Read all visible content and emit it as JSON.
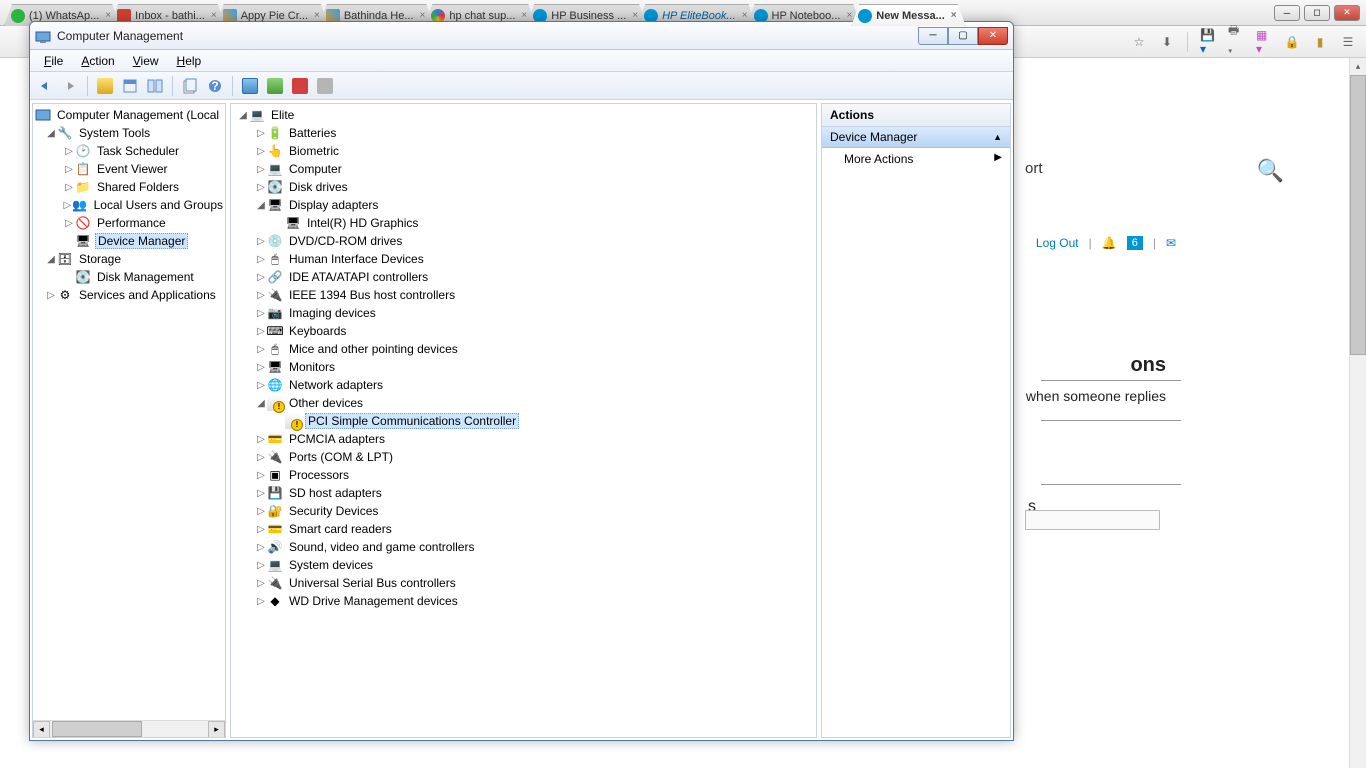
{
  "browser": {
    "tabs": [
      {
        "label": "(1) WhatsAp...",
        "fav": "#2ab540"
      },
      {
        "label": "Inbox - bathi...",
        "fav": "#d04030"
      },
      {
        "label": "Appy Pie Cr...",
        "fav": "#3a88c8"
      },
      {
        "label": "Bathinda He...",
        "fav": "#3a88c8"
      },
      {
        "label": "hp chat sup...",
        "fav": "#3b78e0"
      },
      {
        "label": "HP Business ...",
        "fav": "#0096d6"
      },
      {
        "label": "HP EliteBook...",
        "fav": "#0096d6",
        "italic": true
      },
      {
        "label": "HP Noteboo...",
        "fav": "#0096d6"
      },
      {
        "label": "New Messa...",
        "fav": "#0096d6",
        "active": true
      }
    ],
    "toolbar_icons": [
      "star",
      "download",
      "save",
      "print",
      "apps",
      "lock",
      "library",
      "menu"
    ]
  },
  "bg": {
    "logout": "Log Out",
    "notif_count": "6",
    "section1": "ons",
    "section1_sub": "when someone replies",
    "section2_tail": "s",
    "support_tail": "ort"
  },
  "mmc": {
    "title": "Computer Management",
    "menus": [
      "File",
      "Action",
      "View",
      "Help"
    ],
    "left_tree": {
      "root": "Computer Management (Local",
      "system_tools": "System Tools",
      "st_items": [
        "Task Scheduler",
        "Event Viewer",
        "Shared Folders",
        "Local Users and Groups",
        "Performance",
        "Device Manager"
      ],
      "storage": "Storage",
      "storage_items": [
        "Disk Management"
      ],
      "services": "Services and Applications"
    },
    "center": {
      "root": "Elite",
      "items": [
        "Batteries",
        "Biometric",
        "Computer",
        "Disk drives"
      ],
      "display": "Display adapters",
      "display_child": "Intel(R) HD Graphics",
      "items2": [
        "DVD/CD-ROM drives",
        "Human Interface Devices",
        "IDE ATA/ATAPI controllers",
        "IEEE 1394 Bus host controllers",
        "Imaging devices",
        "Keyboards",
        "Mice and other pointing devices",
        "Monitors",
        "Network adapters"
      ],
      "other": "Other devices",
      "other_child": "PCI Simple Communications Controller",
      "items3": [
        "PCMCIA adapters",
        "Ports (COM & LPT)",
        "Processors",
        "SD host adapters",
        "Security Devices",
        "Smart card readers",
        "Sound, video and game controllers",
        "System devices",
        "Universal Serial Bus controllers",
        "WD Drive Management devices"
      ]
    },
    "actions": {
      "header": "Actions",
      "sub": "Device Manager",
      "more": "More Actions"
    }
  }
}
